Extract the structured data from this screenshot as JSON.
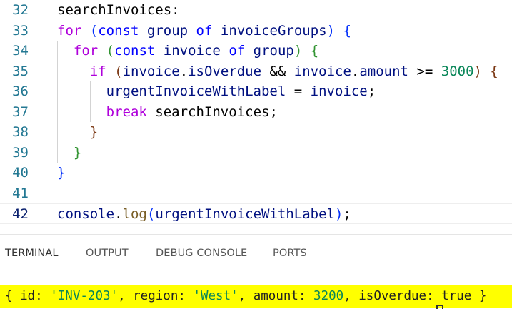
{
  "editor": {
    "lines": [
      {
        "num": "32",
        "tokens": [
          {
            "t": "searchInvoices",
            "c": "tok"
          },
          {
            "t": ":",
            "c": "tok"
          }
        ]
      },
      {
        "num": "33",
        "tokens": [
          {
            "t": "for",
            "c": "kw"
          },
          {
            "t": " ",
            "c": "tok"
          },
          {
            "t": "(",
            "c": "b1"
          },
          {
            "t": "const",
            "c": "st"
          },
          {
            "t": " ",
            "c": "tok"
          },
          {
            "t": "group",
            "c": "var"
          },
          {
            "t": " ",
            "c": "tok"
          },
          {
            "t": "of",
            "c": "st"
          },
          {
            "t": " ",
            "c": "tok"
          },
          {
            "t": "invoiceGroups",
            "c": "var"
          },
          {
            "t": ")",
            "c": "b1"
          },
          {
            "t": " ",
            "c": "tok"
          },
          {
            "t": "{",
            "c": "b1"
          }
        ]
      },
      {
        "num": "34",
        "tokens": [
          {
            "t": "  ",
            "c": "tok"
          },
          {
            "t": "for",
            "c": "kw"
          },
          {
            "t": " ",
            "c": "tok"
          },
          {
            "t": "(",
            "c": "b2"
          },
          {
            "t": "const",
            "c": "st"
          },
          {
            "t": " ",
            "c": "tok"
          },
          {
            "t": "invoice",
            "c": "var"
          },
          {
            "t": " ",
            "c": "tok"
          },
          {
            "t": "of",
            "c": "st"
          },
          {
            "t": " ",
            "c": "tok"
          },
          {
            "t": "group",
            "c": "var"
          },
          {
            "t": ")",
            "c": "b2"
          },
          {
            "t": " ",
            "c": "tok"
          },
          {
            "t": "{",
            "c": "b2"
          }
        ]
      },
      {
        "num": "35",
        "tokens": [
          {
            "t": "    ",
            "c": "tok"
          },
          {
            "t": "if",
            "c": "kw"
          },
          {
            "t": " ",
            "c": "tok"
          },
          {
            "t": "(",
            "c": "b3"
          },
          {
            "t": "invoice",
            "c": "var"
          },
          {
            "t": ".",
            "c": "tok"
          },
          {
            "t": "isOverdue",
            "c": "var"
          },
          {
            "t": " && ",
            "c": "tok"
          },
          {
            "t": "invoice",
            "c": "var"
          },
          {
            "t": ".",
            "c": "tok"
          },
          {
            "t": "amount",
            "c": "var"
          },
          {
            "t": " >= ",
            "c": "tok"
          },
          {
            "t": "3000",
            "c": "num"
          },
          {
            "t": ")",
            "c": "b3"
          },
          {
            "t": " ",
            "c": "tok"
          },
          {
            "t": "{",
            "c": "b3"
          }
        ]
      },
      {
        "num": "36",
        "tokens": [
          {
            "t": "      ",
            "c": "tok"
          },
          {
            "t": "urgentInvoiceWithLabel",
            "c": "var"
          },
          {
            "t": " = ",
            "c": "tok"
          },
          {
            "t": "invoice",
            "c": "var"
          },
          {
            "t": ";",
            "c": "tok"
          }
        ]
      },
      {
        "num": "37",
        "tokens": [
          {
            "t": "      ",
            "c": "tok"
          },
          {
            "t": "break",
            "c": "kw"
          },
          {
            "t": " ",
            "c": "tok"
          },
          {
            "t": "searchInvoices",
            "c": "tok"
          },
          {
            "t": ";",
            "c": "tok"
          }
        ]
      },
      {
        "num": "38",
        "tokens": [
          {
            "t": "    ",
            "c": "tok"
          },
          {
            "t": "}",
            "c": "b3"
          }
        ]
      },
      {
        "num": "39",
        "tokens": [
          {
            "t": "  ",
            "c": "tok"
          },
          {
            "t": "}",
            "c": "b2"
          }
        ]
      },
      {
        "num": "40",
        "tokens": [
          {
            "t": "}",
            "c": "b1"
          }
        ]
      },
      {
        "num": "41",
        "tokens": []
      },
      {
        "num": "42",
        "tokens": [
          {
            "t": "console",
            "c": "var"
          },
          {
            "t": ".",
            "c": "tok"
          },
          {
            "t": "log",
            "c": "fn"
          },
          {
            "t": "(",
            "c": "b1"
          },
          {
            "t": "urgentInvoiceWithLabel",
            "c": "var"
          },
          {
            "t": ")",
            "c": "b1"
          },
          {
            "t": ";",
            "c": "tok"
          }
        ]
      }
    ]
  },
  "panel": {
    "tabs": [
      {
        "label": "TERMINAL",
        "active": true
      },
      {
        "label": "OUTPUT",
        "active": false
      },
      {
        "label": "DEBUG CONSOLE",
        "active": false
      },
      {
        "label": "PORTS",
        "active": false
      }
    ]
  },
  "terminal": {
    "open": "{ ",
    "id_key": "id: ",
    "id_val": "'INV-203'",
    "sep1": ", ",
    "region_key": "region: ",
    "region_val": "'West'",
    "sep2": ", ",
    "amount_key": "amount: ",
    "amount_val": "3200",
    "sep3": ", ",
    "overdue_key": "isOverdue: ",
    "overdue_val": "true",
    "close": " }"
  }
}
